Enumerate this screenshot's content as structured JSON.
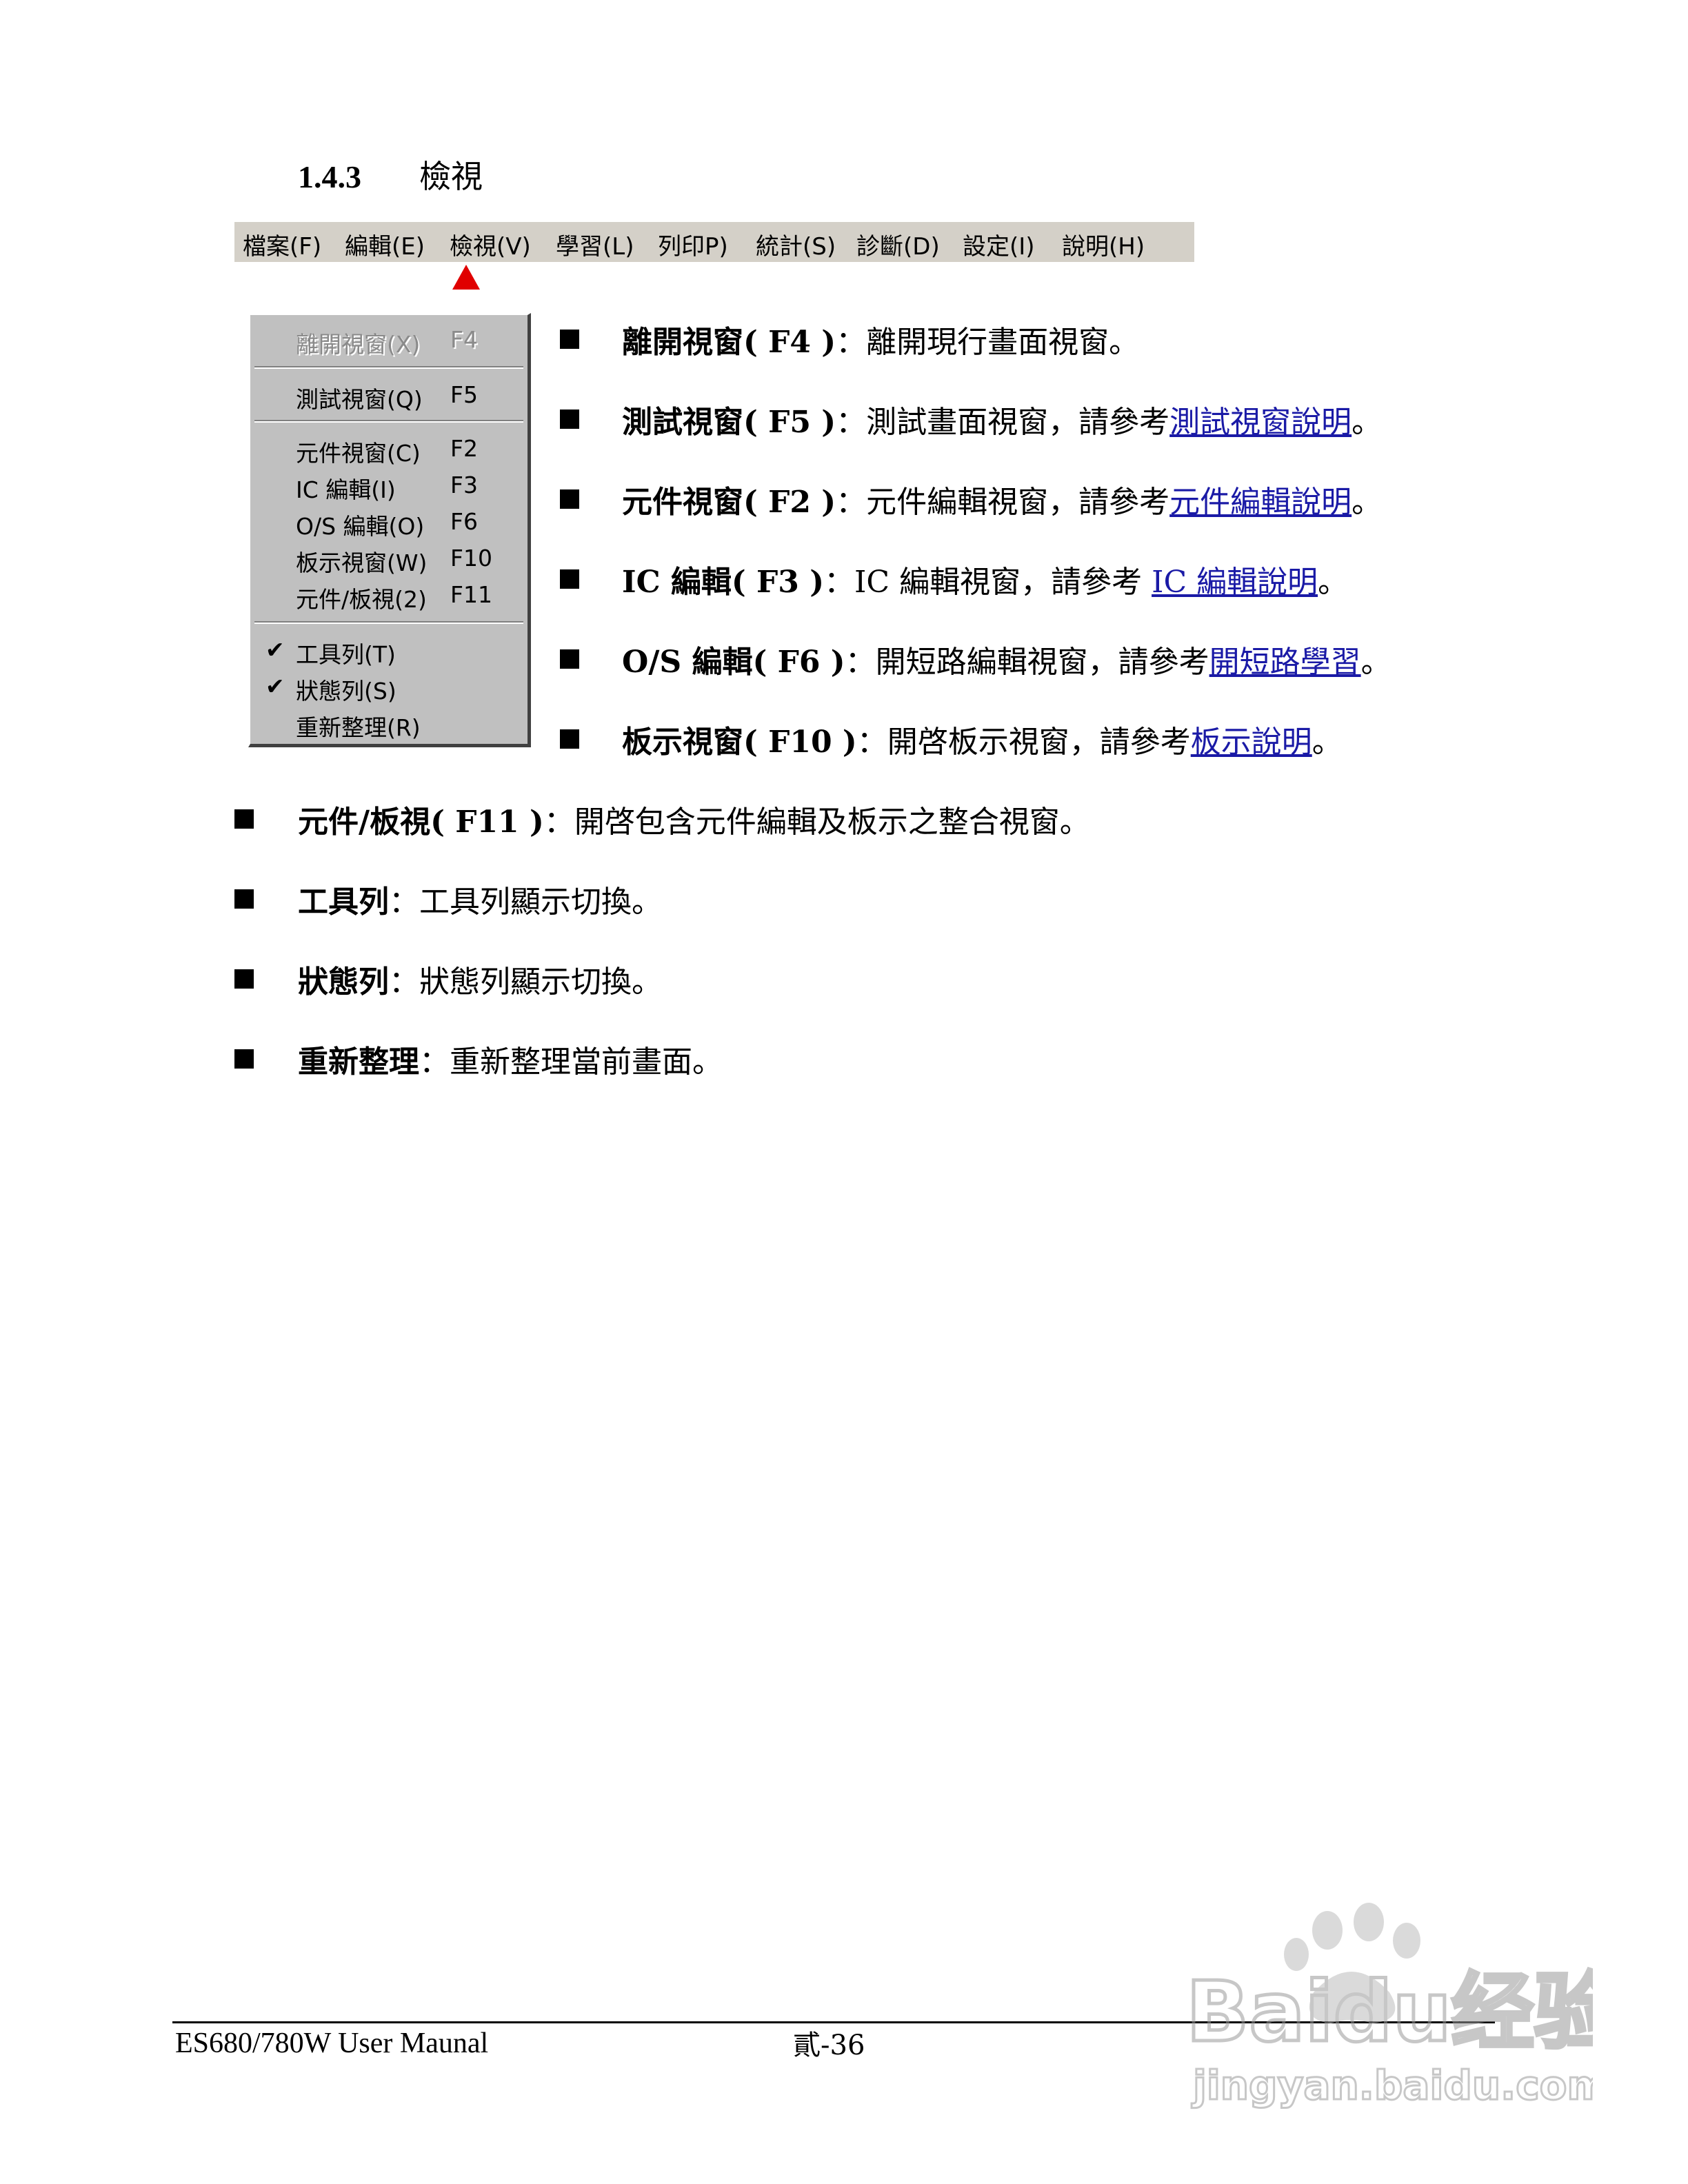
{
  "heading": {
    "number": "1.4.3",
    "title": "檢視"
  },
  "menubar": {
    "items": [
      "檔案(F)",
      "編輯(E)",
      "檢視(V)",
      "學習(L)",
      "列印P)",
      "統計(S)",
      "診斷(D)",
      "設定(I)",
      "說明(H)"
    ]
  },
  "dropdown": {
    "items": [
      {
        "label": "離開視窗(X)",
        "key": "F4"
      },
      {
        "label": "測試視窗(Q)",
        "key": "F5"
      },
      {
        "label": "元件視窗(C)",
        "key": "F2"
      },
      {
        "label": "IC 編輯(I)",
        "key": "F3"
      },
      {
        "label": "O/S 編輯(O)",
        "key": "F6"
      },
      {
        "label": "板示視窗(W)",
        "key": "F10"
      },
      {
        "label": "元件/板視(2)",
        "key": "F11"
      },
      {
        "label": "工具列(T)",
        "check": "✔"
      },
      {
        "label": "狀態列(S)",
        "check": "✔"
      },
      {
        "label": "重新整理(R)"
      }
    ]
  },
  "descriptions": [
    {
      "term": "離開視窗( F4 )",
      "colon": "：",
      "text": "離開現行畫面視窗。"
    },
    {
      "term": "測試視窗( F5 )",
      "colon": "：",
      "text": "測試畫面視窗，請參考",
      "link": "測試視窗說明",
      "end": "。"
    },
    {
      "term": "元件視窗( F2 )",
      "colon": "：",
      "text": "元件編輯視窗，請參考",
      "link": "元件編輯說明",
      "end": "。"
    },
    {
      "term": "IC 編輯( F3 )",
      "colon": "：",
      "text": "IC 編輯視窗，請參考 ",
      "link": "IC 編輯說明",
      "end": "。"
    },
    {
      "term": "O/S 編輯( F6 )",
      "colon": "：",
      "text": "開短路編輯視窗，請參考",
      "link": "開短路學習",
      "end": "。"
    },
    {
      "term": "板示視窗( F10 )",
      "colon": "：",
      "text": "開啓板示視窗，請參考",
      "link": "板示說明",
      "end": "。"
    },
    {
      "term": "元件/板視( F11 )",
      "colon": "：",
      "text": "開啓包含元件編輯及板示之整合視窗。"
    },
    {
      "term": "工具列",
      "colon": "：",
      "text": "工具列顯示切換。"
    },
    {
      "term": "狀態列",
      "colon": "：",
      "text": "狀態列顯示切換。"
    },
    {
      "term": "重新整理",
      "colon": "：",
      "text": "重新整理當前畫面。"
    }
  ],
  "footer": {
    "manual": "ES680/780W User Maunal",
    "page": "貳-36"
  },
  "watermark": {
    "brand": "Baidu经验",
    "url": "jingyan.baidu.com"
  }
}
